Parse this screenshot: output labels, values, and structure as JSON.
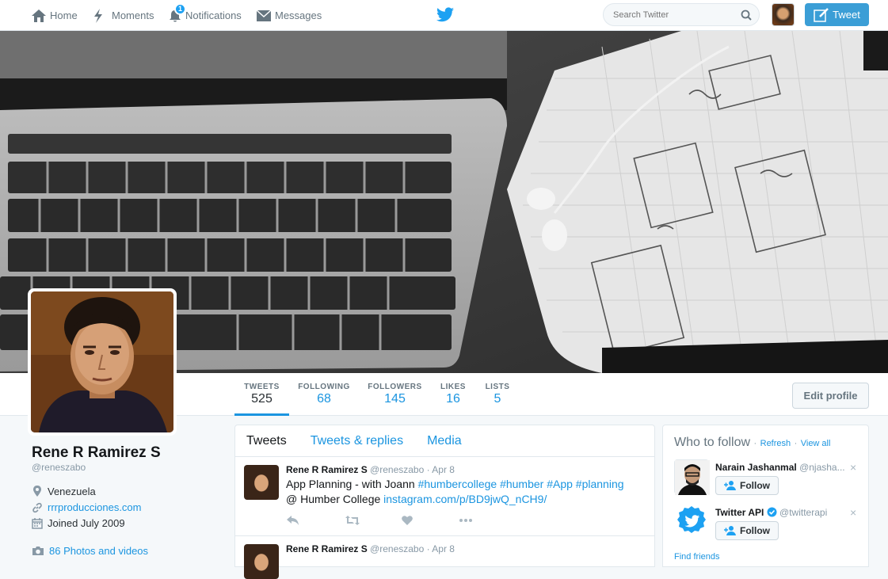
{
  "nav": {
    "home": "Home",
    "moments": "Moments",
    "notifications": "Notifications",
    "notifications_badge": "1",
    "messages": "Messages",
    "search_placeholder": "Search Twitter",
    "tweet_button": "Tweet"
  },
  "profile": {
    "name": "Rene R Ramirez S",
    "handle": "@reneszabo",
    "location": "Venezuela",
    "website": "rrrproducciones.com",
    "joined": "Joined July 2009",
    "photos": "86 Photos and videos"
  },
  "stats": [
    {
      "label": "TWEETS",
      "value": "525"
    },
    {
      "label": "FOLLOWING",
      "value": "68"
    },
    {
      "label": "FOLLOWERS",
      "value": "145"
    },
    {
      "label": "LIKES",
      "value": "16"
    },
    {
      "label": "LISTS",
      "value": "5"
    }
  ],
  "edit_profile": "Edit profile",
  "timeline": {
    "tabs": [
      "Tweets",
      "Tweets & replies",
      "Media"
    ],
    "tweets": [
      {
        "name": "Rene R Ramirez S",
        "handle": "@reneszabo",
        "date": "· Apr 8",
        "text_plain1": "App Planning - with Joann ",
        "hashtags": "#humbercollege #humber #App #planning",
        "text_plain2": "@ Humber College ",
        "link": "instagram.com/p/BD9jwQ_nCH9/"
      },
      {
        "name": "Rene R Ramirez S",
        "handle": "@reneszabo",
        "date": "· Apr 8"
      }
    ]
  },
  "who_to_follow": {
    "title": "Who to follow",
    "refresh": "Refresh",
    "separator": "·",
    "view_all": "View all",
    "follow_label": "Follow",
    "close": "×",
    "recommendations": [
      {
        "name": "Narain Jashanmal",
        "handle": "@njasha..."
      },
      {
        "name": "Twitter API",
        "handle": "@twitterapi"
      }
    ],
    "find_friends": "Find friends"
  },
  "colors": {
    "accent": "#1b95e0",
    "tweet_button": "#3b9ed6",
    "twitter_blue": "#1da1f2"
  }
}
